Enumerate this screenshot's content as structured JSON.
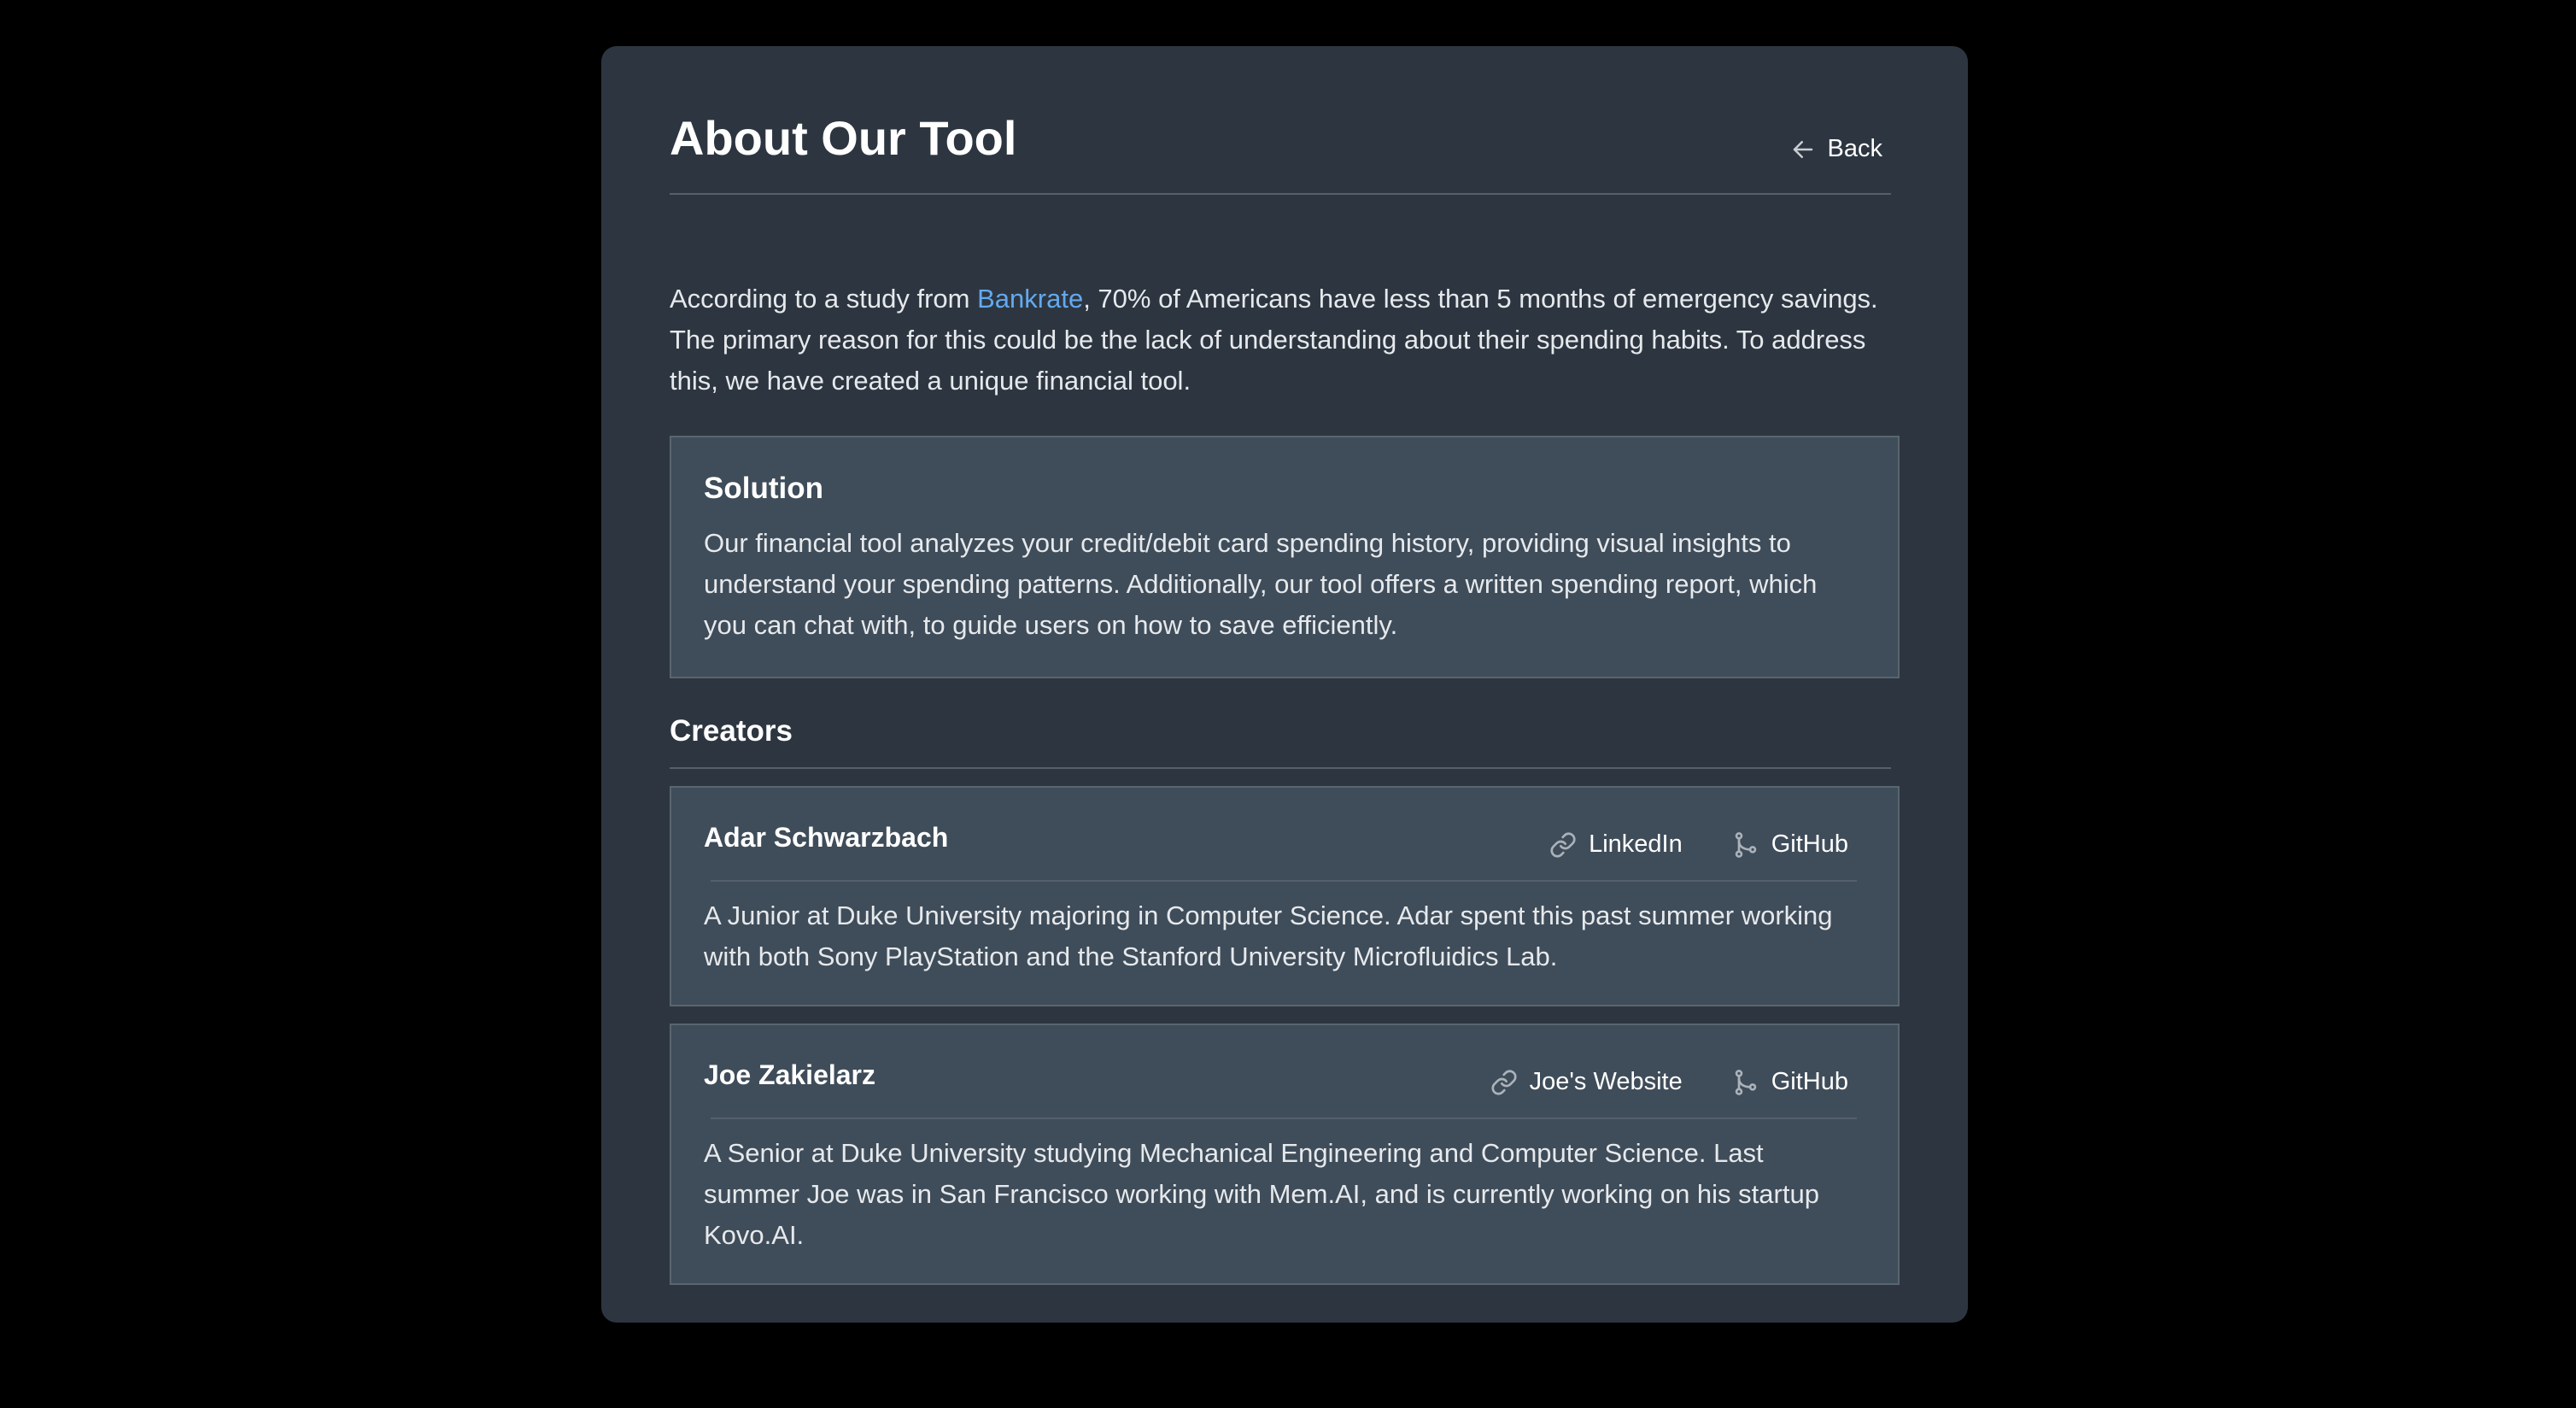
{
  "header": {
    "title": "About Our Tool",
    "back_label": "Back"
  },
  "intro": {
    "before_link": "According to a study from ",
    "link_text": "Bankrate",
    "after_link": ", 70% of Americans have less than 5 months of emergency savings. The primary reason for this could be the lack of understanding about their spending habits. To address this, we have created a unique financial tool."
  },
  "solution": {
    "heading": "Solution",
    "body": "Our financial tool analyzes your credit/debit card spending history, providing visual insights to understand your spending patterns. Additionally, our tool offers a written spending report, which you can chat with, to guide users on how to save efficiently."
  },
  "creators": {
    "heading": "Creators",
    "items": [
      {
        "name": "Adar Schwarzbach",
        "link1_label": "LinkedIn",
        "link2_label": "GitHub",
        "bio": "A Junior at Duke University majoring in Computer Science. Adar spent this past summer working with both Sony PlayStation and the Stanford University Microfluidics Lab."
      },
      {
        "name": "Joe Zakielarz",
        "link1_label": "Joe's Website",
        "link2_label": "GitHub",
        "bio": "A Senior at Duke University studying Mechanical Engineering and Computer Science. Last summer Joe was in San Francisco working with Mem.AI, and is currently working on his startup Kovo.AI."
      }
    ]
  },
  "colors": {
    "page_background": "#000000",
    "card_background": "#2d3640",
    "panel_background": "#3f4c59",
    "link_accent": "#63a9ef"
  },
  "icons": {
    "back": "arrow-left-icon",
    "website": "link-icon",
    "github": "git-branch-icon"
  }
}
